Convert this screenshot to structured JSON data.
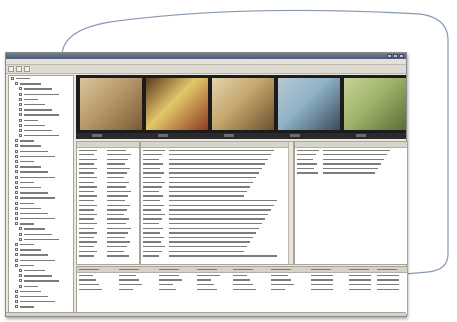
{
  "window": {
    "title": ""
  },
  "menubar": {
    "items": [
      "",
      "",
      "",
      "",
      "",
      ""
    ]
  },
  "toolbar": {
    "buttons": [
      "back-icon",
      "forward-icon",
      "home-icon"
    ]
  },
  "filmstrip": {
    "frames": [
      {
        "name": "frame-portrait",
        "colors": [
          "#b89a6a",
          "#7a5a36",
          "#d9c49b"
        ]
      },
      {
        "name": "frame-interior",
        "colors": [
          "#e4c66a",
          "#8c3c20",
          "#5a3a1e"
        ]
      },
      {
        "name": "frame-machinery",
        "colors": [
          "#c5a66c",
          "#6b5230",
          "#e2d3ae"
        ]
      },
      {
        "name": "frame-ship",
        "colors": [
          "#8fb3c8",
          "#3a4b5a",
          "#b8c7cf"
        ]
      },
      {
        "name": "frame-landscape",
        "colors": [
          "#9fb46a",
          "#5b6d3a",
          "#c7d39a"
        ]
      }
    ]
  },
  "colors": {
    "accent": "#4c5a73",
    "callout": "#8a99b3"
  }
}
